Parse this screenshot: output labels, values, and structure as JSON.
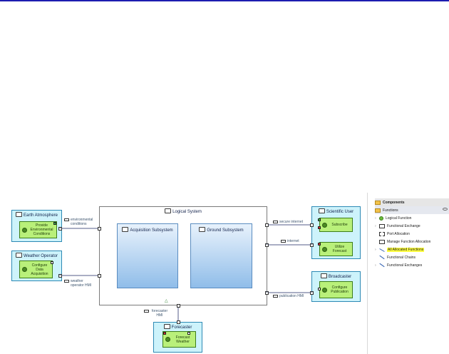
{
  "diagram": {
    "system": {
      "title": "Logical System"
    },
    "subsystems": [
      {
        "title": "Acquisition Subsystem"
      },
      {
        "title": "Ground Subsystem"
      }
    ],
    "actors": {
      "earth_atmosphere": {
        "title": "Earth Atmosphere",
        "function": "Provide Environmental Conditions"
      },
      "weather_operator": {
        "title": "Weather Operator",
        "function": "Configure Data Acquisition"
      },
      "scientific_user": {
        "title": "Scientific User",
        "functions": [
          "Subscribe",
          "Utilize Forecast"
        ]
      },
      "broadcaster": {
        "title": "Broadcaster",
        "function": "Configure Publication"
      },
      "forecaster": {
        "title": "Forecaster",
        "function": "Forecast Weather"
      }
    },
    "exchanges": {
      "environmental": "environmental conditions",
      "weather_hmi": "weather operator HMI",
      "secure_internet": "secure internet",
      "internet": "internet",
      "publication_hmi": "publication HMI",
      "forecaster_hmi": "forecaster HMI"
    }
  },
  "palette": {
    "items": [
      {
        "label": "Components",
        "type": "header",
        "icon": "folder-icon"
      },
      {
        "label": "Functions",
        "type": "header",
        "icon": "folder-icon"
      },
      {
        "label": "Logical Function",
        "icon": "logical-function-icon"
      },
      {
        "label": "Functional Exchange",
        "icon": "functional-exchange-icon"
      },
      {
        "label": "Port Allocation",
        "icon": "port-allocation-icon"
      },
      {
        "label": "Manage Function Allocation",
        "icon": "manage-allocation-icon"
      },
      {
        "label": "All Allocated Functions",
        "icon": "allocated-functions-icon"
      },
      {
        "label": "Functional Chains",
        "icon": "functional-chains-icon"
      },
      {
        "label": "Functional Exchanges",
        "icon": "functional-exchanges-icon"
      }
    ]
  },
  "colors": {
    "actor_fill": "#cdf3fb",
    "function_fill": "#b9f07a",
    "subsystem_fill": "#90bde9",
    "highlight": "#ffff40"
  }
}
